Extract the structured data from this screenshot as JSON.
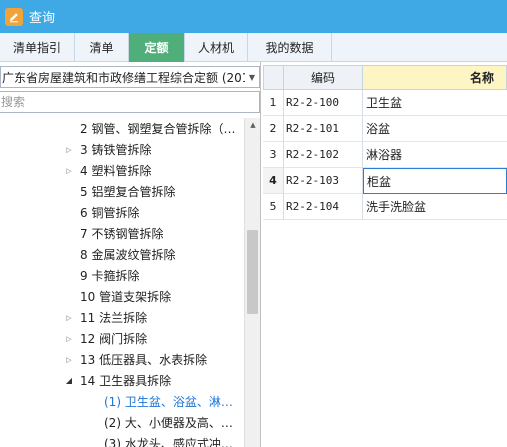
{
  "window": {
    "title": "查询",
    "app_icon": "edit-icon"
  },
  "tabs": [
    {
      "label": "清单指引",
      "active": false
    },
    {
      "label": "清单",
      "active": false
    },
    {
      "label": "定额",
      "active": true
    },
    {
      "label": "人材机",
      "active": false
    },
    {
      "label": "我的数据",
      "active": false
    }
  ],
  "colors": {
    "title_bar": "#3fa9e5",
    "active_tab": "#4fae7a",
    "selected_item": "#1d74d8",
    "name_header": "#fdf6c4",
    "current_row_border": "#2a7fd4"
  },
  "left_panel": {
    "quota_library": "广东省房屋建筑和市政修缮工程综合定额 (201",
    "search_placeholder": "搜索",
    "tree": [
      {
        "label": "2  钢管、钢塑复合管拆除（…",
        "toggle": "none"
      },
      {
        "label": "3  铸铁管拆除",
        "toggle": "collapsed"
      },
      {
        "label": "4  塑料管拆除",
        "toggle": "collapsed"
      },
      {
        "label": "5  铝塑复合管拆除",
        "toggle": "none"
      },
      {
        "label": "6  铜管拆除",
        "toggle": "none"
      },
      {
        "label": "7  不锈钢管拆除",
        "toggle": "none"
      },
      {
        "label": "8  金属波纹管拆除",
        "toggle": "none"
      },
      {
        "label": "9  卡箍拆除",
        "toggle": "none"
      },
      {
        "label": "10  管道支架拆除",
        "toggle": "none"
      },
      {
        "label": "11  法兰拆除",
        "toggle": "collapsed"
      },
      {
        "label": "12  阀门拆除",
        "toggle": "collapsed"
      },
      {
        "label": "13  低压器具、水表拆除",
        "toggle": "collapsed"
      },
      {
        "label": "14  卫生器具拆除",
        "toggle": "expanded"
      },
      {
        "label": "(1)  卫生盆、浴盆、淋…",
        "toggle": "none",
        "selected": true,
        "child": true
      },
      {
        "label": "(2)  大、小便器及高、…",
        "toggle": "none",
        "child": true
      },
      {
        "label": "(3)  水龙头、感应式冲…",
        "toggle": "none",
        "child": true
      }
    ]
  },
  "grid": {
    "headers": {
      "code": "编码",
      "name": "名称"
    },
    "rows": [
      {
        "num": "1",
        "code": "R2-2-100",
        "name": "卫生盆"
      },
      {
        "num": "2",
        "code": "R2-2-101",
        "name": "浴盆"
      },
      {
        "num": "3",
        "code": "R2-2-102",
        "name": "淋浴器"
      },
      {
        "num": "4",
        "code": "R2-2-103",
        "name": "柜盆",
        "current": true
      },
      {
        "num": "5",
        "code": "R2-2-104",
        "name": "洗手洗脸盆"
      }
    ]
  }
}
